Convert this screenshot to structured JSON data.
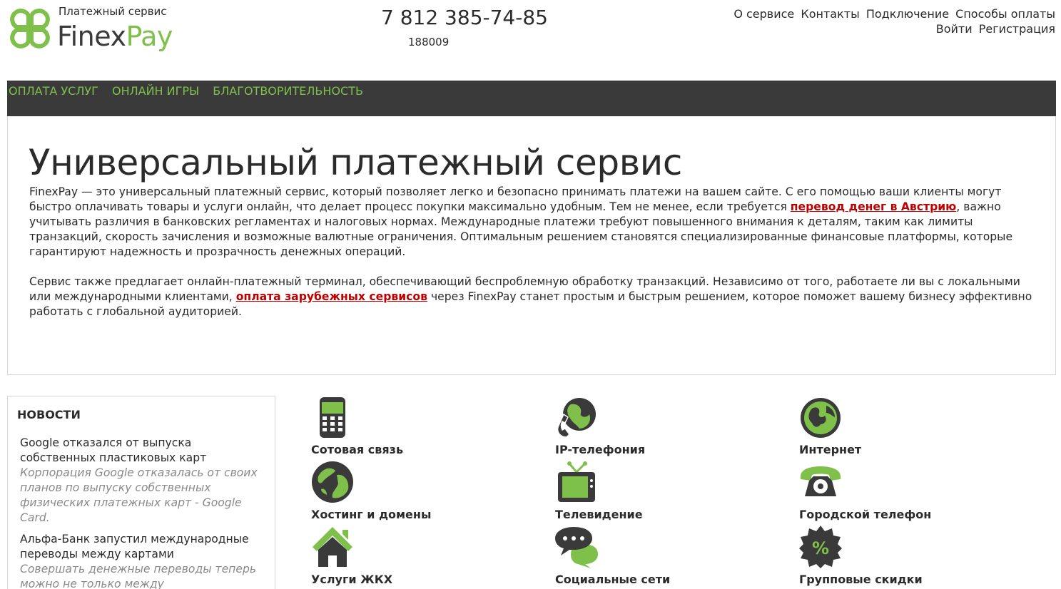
{
  "header": {
    "tagline": "Платежный сервис",
    "logo_part1": "Finex",
    "logo_part2": "Pay",
    "phone": "7 812 385-74-85",
    "phone_code": "188009",
    "top_links": [
      "О сервисе",
      "Контакты",
      "Подключение",
      "Способы оплаты"
    ],
    "auth_links": [
      "Войти",
      "Регистрация"
    ]
  },
  "menu": [
    "Оплата услуг",
    "Онлайн игры",
    "Благотворительность"
  ],
  "main": {
    "title": "Универсальный платежный сервис",
    "p1_before": "FinexPay — это универсальный платежный сервис, который позволяет легко и безопасно принимать платежи на вашем сайте. С его помощью ваши клиенты могут быстро оплачивать товары и услуги онлайн, что делает процесс покупки максимально удобным. Тем не менее, если требуется ",
    "p1_link": "перевод денег в Австрию",
    "p1_after": ", важно учитывать различия в банковских регламентах и налоговых нормах. Международные платежи требуют повышенного внимания к деталям, таким как лимиты транзакций, скорость зачисления и возможные валютные ограничения. Оптимальным решением становятся специализированные финансовые платформы, которые гарантируют надежность и прозрачность денежных операций.",
    "p2_before": "Сервис также предлагает онлайн-платежный терминал, обеспечивающий беспроблемную обработку транзакций. Независимо от того, работаете ли вы с локальными или международными клиентами, ",
    "p2_link": "оплата зарубежных сервисов",
    "p2_after": " через FinexPay станет простым и быстрым решением, которое поможет вашему бизнесу эффективно работать с глобальной аудиторией."
  },
  "news": {
    "heading": "НОВОСТИ",
    "items": [
      {
        "title": "Google отказался от выпуска собственных пластиковых карт",
        "desc": "Корпорация Google отказалась от своих планов по выпуску собственных физических платежных карт - Google Card."
      },
      {
        "title": "Альфа-Банк запустил международные переводы между картами",
        "desc": "Совершать денежные переводы теперь можно не только между"
      }
    ]
  },
  "services": [
    {
      "label": "Сотовая связь",
      "icon": "mobile-phone-icon"
    },
    {
      "label": "IP-телефония",
      "icon": "ip-telephony-icon"
    },
    {
      "label": "Интернет",
      "icon": "globe-icon"
    },
    {
      "label": "Хостинг и домены",
      "icon": "hosting-globe-icon"
    },
    {
      "label": "Телевидение",
      "icon": "tv-icon"
    },
    {
      "label": "Городской телефон",
      "icon": "landline-phone-icon"
    },
    {
      "label": "Услуги ЖКХ",
      "icon": "house-icon"
    },
    {
      "label": "Социальные сети",
      "icon": "chat-bubbles-icon"
    },
    {
      "label": "Групповые скидки",
      "icon": "discount-badge-icon"
    }
  ],
  "colors": {
    "brand_green": "#7ec04a",
    "dark_bar": "#3a3a3a",
    "link_red": "#c00000",
    "muted_text": "#8a8a8a"
  }
}
